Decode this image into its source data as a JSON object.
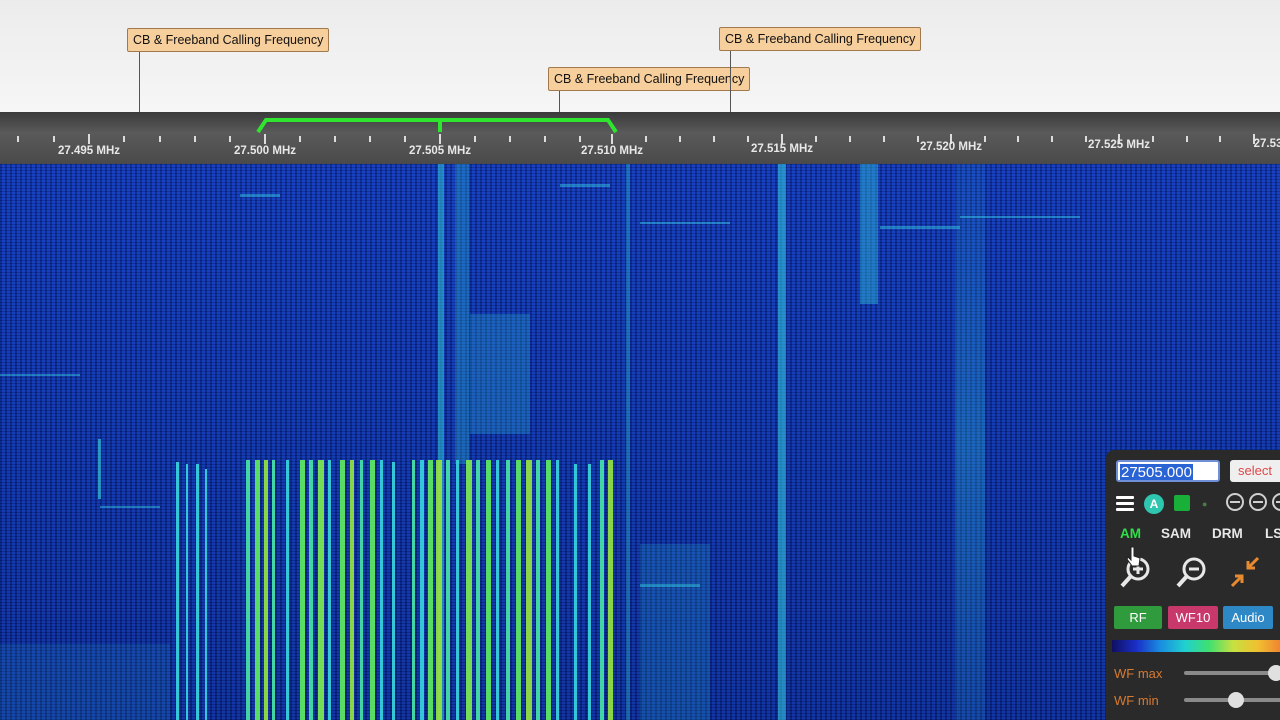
{
  "dx_labels": [
    {
      "text": "CB & Freeband Calling Frequency"
    },
    {
      "text": "CB & Freeband Calling Frequency"
    },
    {
      "text": "CB & Freeband Calling Frequency"
    }
  ],
  "scale": {
    "ticks": [
      "27.495 MHz",
      "27.500 MHz",
      "27.505 MHz",
      "27.510 MHz",
      "27.515 MHz",
      "27.520 MHz",
      "27.525 MHz",
      "27.53"
    ]
  },
  "controls": {
    "frequency_value": "27505.000",
    "select_label": "select",
    "a_label": "A",
    "modes": [
      "AM",
      "SAM",
      "DRM",
      "LS"
    ],
    "active_mode": "AM",
    "pills": {
      "rf": "RF",
      "wf10": "WF10",
      "audio": "Audio"
    },
    "wf_max_label": "WF max",
    "wf_min_label": "WF min",
    "wf_max_level": 0.92,
    "wf_min_level": 0.52
  },
  "colors": {
    "passband": "#2ee42e",
    "rf_pill": "#2f9b3c",
    "wf10_pill": "#c8386a",
    "audio_pill": "#2e88c6",
    "select_text": "#e04848",
    "slider_label": "#d87a30"
  },
  "icons": [
    "menu-icon",
    "a-icon",
    "picture-icon",
    "zoom-in-icon",
    "zoom-out-icon",
    "collapse-icon"
  ]
}
